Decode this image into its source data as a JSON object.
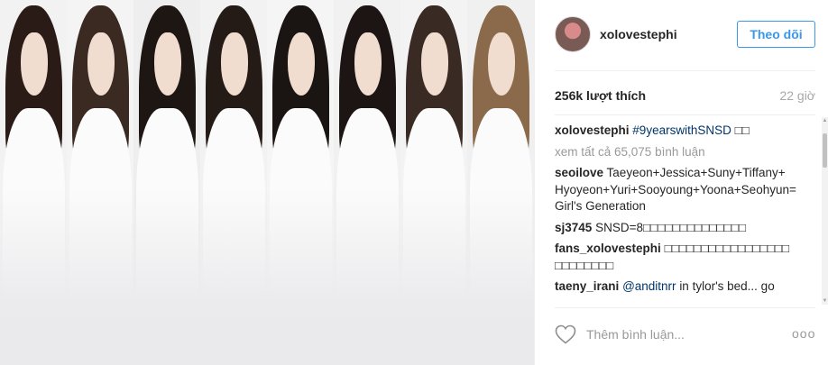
{
  "post": {
    "members": [
      {
        "hair": "#2a1b16",
        "bg": "#f2f2f2"
      },
      {
        "hair": "#3b2a22",
        "bg": "#f4f4f4"
      },
      {
        "hair": "#1e1613",
        "bg": "#eeeeee"
      },
      {
        "hair": "#241a16",
        "bg": "#f2f2f2"
      },
      {
        "hair": "#1a1412",
        "bg": "#f5f5f5"
      },
      {
        "hair": "#1c1513",
        "bg": "#f1f1f1"
      },
      {
        "hair": "#3a2a24",
        "bg": "#f3f3f3"
      },
      {
        "hair": "#8a6a4a",
        "bg": "#f0f0f0"
      }
    ]
  },
  "header": {
    "username": "xolovestephi",
    "follow_label": "Theo dõi",
    "avatar_icon": "profile-avatar"
  },
  "stats": {
    "likes": "256k lượt thích",
    "time": "22 giờ"
  },
  "caption": {
    "user": "xolovestephi",
    "hashtag": "#9yearswithSNSD",
    "emoji": "□□"
  },
  "view_all": "xem tất cả 65,075 bình luận",
  "comments": [
    {
      "user": "seoilove",
      "text": "Taeyeon+Jessica+Suny+Tiffany+ Hyoyeon+Yuri+Sooyoung+Yoona+Seohyun=Girl's Generation"
    },
    {
      "user": "sj3745",
      "text": "SNSD=8□□□□□□□□□□□□□□"
    },
    {
      "user": "fans_xolovestephi",
      "text": "□□□□□□□□□□□□□□□□□ □□□□□□□□"
    },
    {
      "user": "taeny_irani",
      "mention": "@anditnrr",
      "text": "in tylor's bed... go"
    }
  ],
  "footer": {
    "add_comment_placeholder": "Thêm bình luận...",
    "more_label": "ooo",
    "heart_icon": "heart-outline-icon",
    "colors": {
      "accent": "#3897f0",
      "mention": "#003569"
    }
  }
}
